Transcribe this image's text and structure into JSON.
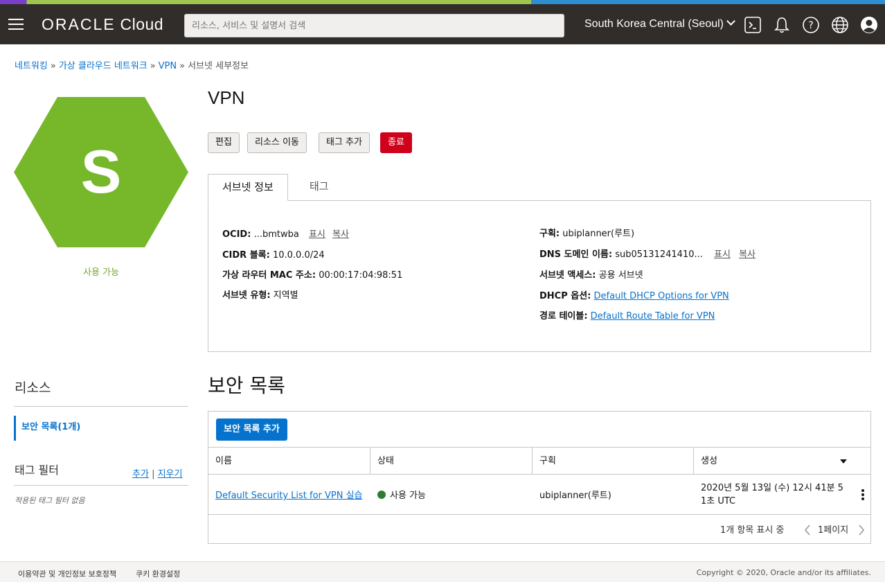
{
  "header": {
    "logo_oracle": "ORACLE",
    "logo_cloud": "Cloud",
    "search_placeholder": "리소스, 서비스 및 설명서 검색",
    "region": "South Korea Central (Seoul)"
  },
  "breadcrumb": {
    "items": [
      "네트워킹",
      "가상 클라우드 네트워크",
      "VPN"
    ],
    "separator": "»",
    "current": "서브넷 세부정보"
  },
  "resource": {
    "letter": "S",
    "status": "사용 가능",
    "name": "VPN",
    "hex_color": "#76b82a"
  },
  "actions": {
    "edit": "편집",
    "move": "리소스 이동",
    "add_tag": "태그 추가",
    "terminate": "종료"
  },
  "tabs": {
    "info": "서브넷 정보",
    "tags": "태그"
  },
  "info": {
    "ocid_label": "OCID:",
    "ocid_value": "...bmtwba",
    "show": "표시",
    "copy": "복사",
    "cidr_label": "CIDR 블록:",
    "cidr_value": "10.0.0.0/24",
    "mac_label": "가상 라우터 MAC 주소:",
    "mac_value": "00:00:17:04:98:51",
    "type_label": "서브넷 유형:",
    "type_value": "지역별",
    "compartment_label": "구획:",
    "compartment_value": "ubiplanner(루트)",
    "dns_label": "DNS 도메인 이름:",
    "dns_value": "sub05131241410...",
    "access_label": "서브넷 액세스:",
    "access_value": "공용 서브넷",
    "dhcp_label": "DHCP 옵션:",
    "dhcp_value": "Default DHCP Options for VPN",
    "route_label": "경로 테이블:",
    "route_value": "Default Route Table for VPN"
  },
  "sidebar": {
    "resources_title": "리소스",
    "security_lists_item": "보안 목록(1개)",
    "tag_filter_title": "태그 필터",
    "add": "추가",
    "pipe": "|",
    "clear": "지우기",
    "no_filters": "적용된 태그 필터 없음"
  },
  "security_lists": {
    "title": "보안 목록",
    "add_button": "보안 목록 추가",
    "columns": [
      "이름",
      "상태",
      "구획",
      "생성"
    ],
    "rows": [
      {
        "name": "Default Security List for VPN 실습",
        "status": "사용 가능",
        "compartment": "ubiplanner(루트)",
        "created_line1": "2020년 5월 13일 (수) 12시 41분 5",
        "created_line2": "1초 UTC"
      }
    ],
    "count_text": "1개 항목 표시 중",
    "page_text": "1페이지",
    "status_color": "#2f7d32"
  },
  "footer": {
    "terms": "이용약관 및 개인정보 보호정책",
    "cookies": "쿠키 환경설정",
    "copyright": "Copyright © 2020, Oracle and/or its affiliates."
  }
}
